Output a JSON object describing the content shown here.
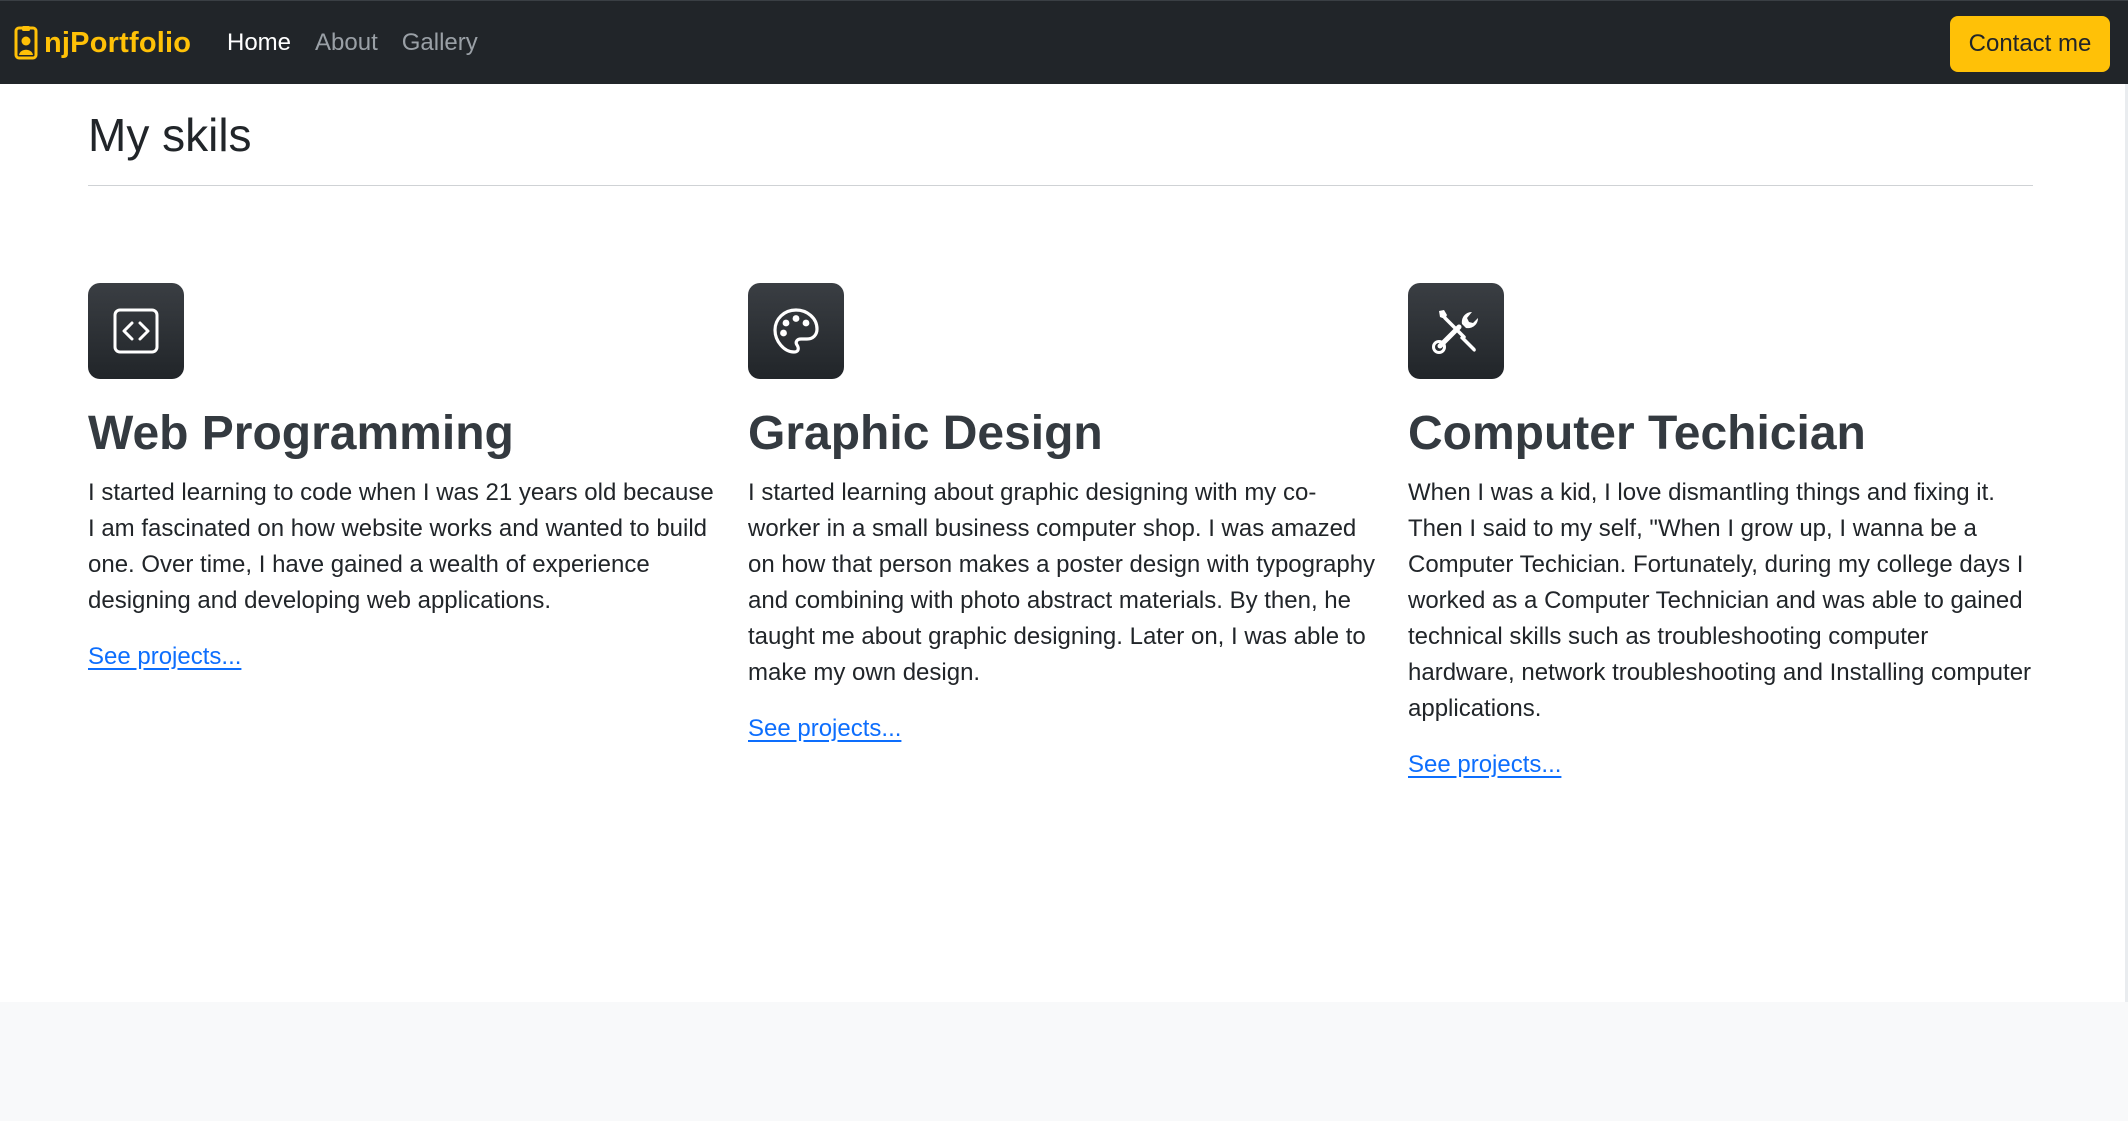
{
  "navbar": {
    "brand": "njPortfolio",
    "links": [
      {
        "label": "Home"
      },
      {
        "label": "About"
      },
      {
        "label": "Gallery"
      }
    ],
    "contact_label": "Contact me"
  },
  "main": {
    "title": "My skils",
    "features": [
      {
        "icon": "code-square-icon",
        "title": "Web Programming",
        "text": "I started learning to code when I was 21 years old because I am fascinated on how website works and wanted to build one. Over time, I have gained a wealth of experience designing and developing web applications.",
        "link": "See projects..."
      },
      {
        "icon": "palette-icon",
        "title": "Graphic Design",
        "text": "I started learning about graphic designing with my co-worker in a small business computer shop. I was amazed on how that person makes a poster design with typography and combining with photo abstract materials. By then, he taught me about graphic designing. Later on, I was able to make my own design.",
        "link": "See projects..."
      },
      {
        "icon": "tools-icon",
        "title": "Computer Techician",
        "text": "When I was a kid, I love dismantling things and fixing it. Then I said to my self, \"When I grow up, I wanna be a Computer Techician. Fortunately, during my college days I worked as a Computer Technician and was able to gained technical skills such as troubleshooting computer hardware, network troubleshooting and Installing computer applications.",
        "link": "See projects..."
      }
    ]
  },
  "colors": {
    "navbar_bg": "#212529",
    "accent": "#ffc107",
    "link": "#0d6efd",
    "icon_bg": "#212529"
  }
}
